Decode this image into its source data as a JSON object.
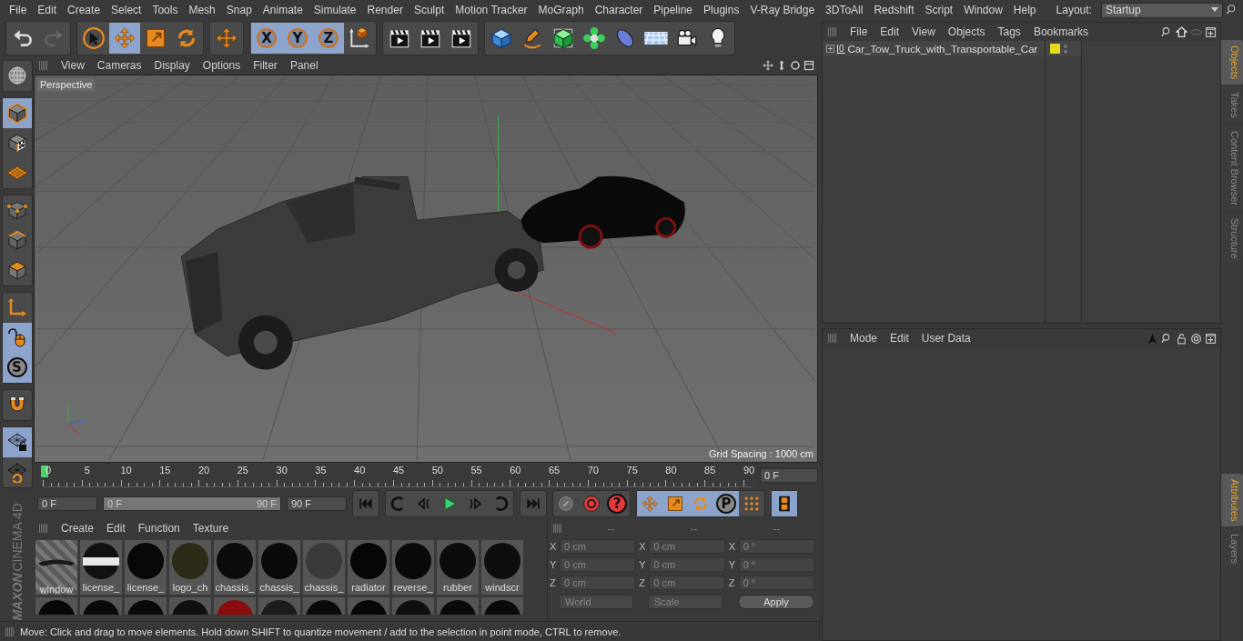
{
  "menu_bar": {
    "items": [
      "File",
      "Edit",
      "Create",
      "Select",
      "Tools",
      "Mesh",
      "Snap",
      "Animate",
      "Simulate",
      "Render",
      "Sculpt",
      "Motion Tracker",
      "MoGraph",
      "Character",
      "Pipeline",
      "Plugins",
      "V-Ray Bridge",
      "3DToAll",
      "Redshift",
      "Script",
      "Window",
      "Help"
    ],
    "layout_label": "Layout:",
    "layout_value": "Startup"
  },
  "toolbar": {
    "groups": [
      {
        "tools": [
          {
            "kind": "undo",
            "selected": false
          },
          {
            "kind": "redo",
            "selected": false
          }
        ]
      },
      {
        "tools": [
          {
            "kind": "select",
            "selected": false
          },
          {
            "kind": "move",
            "selected": true
          },
          {
            "kind": "scale",
            "selected": false
          },
          {
            "kind": "rotate",
            "selected": false
          }
        ]
      },
      {
        "tools": [
          {
            "kind": "move",
            "selected": false
          }
        ]
      },
      {
        "tools": [
          {
            "kind": "axis",
            "label": "X",
            "selected": true
          },
          {
            "kind": "axis",
            "label": "Y",
            "selected": true
          },
          {
            "kind": "axis",
            "label": "Z",
            "selected": true
          },
          {
            "kind": "coord",
            "selected": false
          }
        ]
      },
      {
        "tools": [
          {
            "kind": "clapper",
            "selected": false
          },
          {
            "kind": "clapper",
            "selected": false
          },
          {
            "kind": "clapper",
            "selected": false
          }
        ]
      },
      {
        "tools": [
          {
            "kind": "cube",
            "selected": false
          },
          {
            "kind": "pen",
            "selected": false
          },
          {
            "kind": "greencube",
            "selected": false
          },
          {
            "kind": "flower",
            "selected": false
          },
          {
            "kind": "deformer",
            "selected": false
          },
          {
            "kind": "floor",
            "selected": false
          },
          {
            "kind": "camera",
            "selected": false
          },
          {
            "kind": "bulb",
            "selected": false
          }
        ]
      }
    ]
  },
  "side_tools": {
    "groups": [
      {
        "tools": [
          {
            "kind": "globe",
            "selected": false
          }
        ]
      },
      {
        "tools": [
          {
            "kind": "modelcube",
            "selected": true
          },
          {
            "kind": "checkercube",
            "selected": false
          },
          {
            "kind": "gridplane",
            "selected": false
          }
        ]
      },
      {
        "tools": [
          {
            "kind": "pointscube",
            "selected": false
          },
          {
            "kind": "edgescube",
            "selected": false
          },
          {
            "kind": "polyscube",
            "selected": false
          }
        ]
      },
      {
        "tools": [
          {
            "kind": "axisl",
            "selected": false
          },
          {
            "kind": "mouse",
            "selected": true
          },
          {
            "kind": "letter",
            "label": "S",
            "selected": true
          }
        ]
      },
      {
        "tools": [
          {
            "kind": "magnet",
            "selected": false
          }
        ]
      },
      {
        "tools": [
          {
            "kind": "gridlock",
            "selected": true
          },
          {
            "kind": "gridsync",
            "selected": false
          }
        ]
      }
    ],
    "logo_brand": "MAXON",
    "logo_product": "CINEMA 4D"
  },
  "viewport": {
    "menu": [
      "View",
      "Cameras",
      "Display",
      "Options",
      "Filter",
      "Panel"
    ],
    "camera_label": "Perspective",
    "grid_spacing": "Grid Spacing : 1000 cm"
  },
  "timeline": {
    "ticks": [
      "0",
      "5",
      "10",
      "15",
      "20",
      "25",
      "30",
      "35",
      "40",
      "45",
      "50",
      "55",
      "60",
      "65",
      "70",
      "75",
      "80",
      "85",
      "90"
    ],
    "playhead": {
      "level": 0
    },
    "current_frame": "0 F"
  },
  "transport": {
    "start": "0 F",
    "range": {
      "start": "0 F",
      "end": "90 F",
      "level": 1
    },
    "end": "90 F",
    "groups": [
      {
        "tools": [
          {
            "kind": "gostart",
            "selected": false
          }
        ]
      },
      {
        "tools": [
          {
            "kind": "prevkey",
            "selected": false
          },
          {
            "kind": "prevframe",
            "selected": false
          },
          {
            "kind": "play",
            "selected": false
          },
          {
            "kind": "nextframe",
            "selected": false
          },
          {
            "kind": "nextkey",
            "selected": false
          }
        ]
      },
      {
        "tools": [
          {
            "kind": "goend",
            "selected": false
          }
        ]
      },
      {
        "tools": [
          {
            "kind": "record",
            "selected": false
          },
          {
            "kind": "autokey",
            "selected": false
          },
          {
            "kind": "help",
            "label": "?",
            "selected": false
          }
        ]
      },
      {
        "tools": [
          {
            "kind": "move",
            "selected": true
          },
          {
            "kind": "scale",
            "selected": true
          },
          {
            "kind": "rotate",
            "selected": true
          },
          {
            "kind": "letter",
            "label": "P",
            "selected": true
          },
          {
            "kind": "dots",
            "selected": false
          }
        ]
      },
      {
        "tools": [
          {
            "kind": "film",
            "selected": true
          }
        ]
      }
    ]
  },
  "materials": {
    "menu": [
      "Create",
      "Edit",
      "Function",
      "Texture"
    ],
    "items": [
      {
        "name": "window",
        "kind": "striped",
        "color": "#1a1a1a"
      },
      {
        "name": "license_",
        "kind": "plate",
        "color": "#e8e8e8"
      },
      {
        "name": "license_",
        "kind": "sphere",
        "color": "#080808"
      },
      {
        "name": "logo_ch",
        "kind": "sphere",
        "color": "#2e2a18"
      },
      {
        "name": "chassis_",
        "kind": "sphere",
        "color": "#0c0c0c"
      },
      {
        "name": "chassis_",
        "kind": "sphere",
        "color": "#0a0a0a"
      },
      {
        "name": "chassis_",
        "kind": "sphere",
        "color": "#3a3a3a"
      },
      {
        "name": "radiator",
        "kind": "sphere",
        "color": "#060606"
      },
      {
        "name": "reverse_",
        "kind": "sphere",
        "color": "#0a0a0a"
      },
      {
        "name": "rubber",
        "kind": "sphere",
        "color": "#0c0c0c"
      },
      {
        "name": "windscr",
        "kind": "sphere",
        "color": "#0e0e0e"
      },
      {
        "kind": "sphere",
        "color": "#080808"
      },
      {
        "kind": "sphere",
        "color": "#0a0a0a"
      },
      {
        "kind": "sphere",
        "color": "#0a0a0a"
      },
      {
        "kind": "sphere",
        "color": "#101010"
      },
      {
        "kind": "sphere",
        "color": "#8a0c0c"
      },
      {
        "kind": "sphere",
        "color": "#1c1c1c"
      },
      {
        "kind": "sphere",
        "color": "#0a0a0a"
      },
      {
        "kind": "sphere",
        "color": "#080808"
      },
      {
        "kind": "sphere",
        "color": "#101010"
      },
      {
        "kind": "sphere",
        "color": "#0a0a0a"
      },
      {
        "kind": "sphere",
        "color": "#0a0a0a"
      }
    ]
  },
  "coordinates": {
    "headers": [
      "--",
      "--",
      "--"
    ],
    "rows": [
      {
        "cells": [
          {
            "axis": "X",
            "value": "0 cm"
          },
          {
            "axis": "X",
            "value": "0 cm"
          },
          {
            "axis": "X",
            "value": "0 °"
          }
        ]
      },
      {
        "cells": [
          {
            "axis": "Y",
            "value": "0 cm"
          },
          {
            "axis": "Y",
            "value": "0 cm"
          },
          {
            "axis": "Y",
            "value": "0 °"
          }
        ]
      },
      {
        "cells": [
          {
            "axis": "Z",
            "value": "0 cm"
          },
          {
            "axis": "Z",
            "value": "0 cm"
          },
          {
            "axis": "Z",
            "value": "0 °"
          }
        ]
      }
    ],
    "space_dropdown": "World",
    "mode_dropdown": "Scale",
    "apply_button": "Apply"
  },
  "status_bar": "Move: Click and drag to move elements. Hold down SHIFT to quantize movement / add to the selection in point mode, CTRL to remove.",
  "object_manager": {
    "menu": [
      "File",
      "Edit",
      "View",
      "Objects",
      "Tags",
      "Bookmarks"
    ],
    "objects": [
      {
        "name": "Car_Tow_Truck_with_Transportable_Car",
        "layer_label": "0",
        "color": "#e2db1e",
        "expanded": false
      }
    ]
  },
  "attribute_manager": {
    "menu": [
      "Mode",
      "Edit",
      "User Data"
    ]
  },
  "side_tabs": [
    {
      "label": "Objects",
      "selected": true
    },
    {
      "label": "Takes",
      "selected": false
    },
    {
      "label": "Content Browser",
      "selected": false
    },
    {
      "label": "Structure",
      "selected": false
    }
  ],
  "side_tabs_lower": [
    {
      "label": "Attributes",
      "selected": true
    },
    {
      "label": "Layers",
      "selected": false
    }
  ]
}
